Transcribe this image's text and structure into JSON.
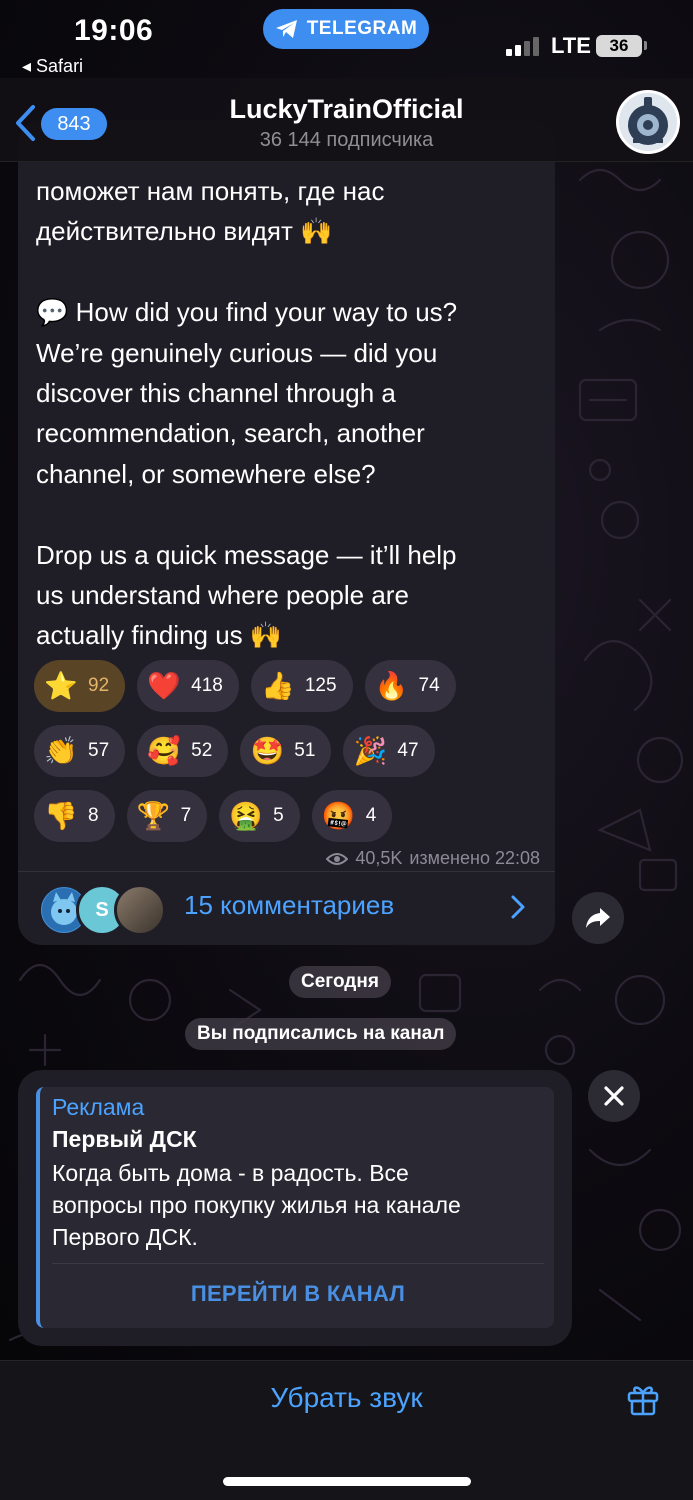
{
  "status_bar": {
    "time": "19:06",
    "back_app": "◂ Safari",
    "app_pill": "TELEGRAM",
    "network": "LTE",
    "battery": "36"
  },
  "header": {
    "back_count": "843",
    "title": "LuckyTrainOfficial",
    "subtitle": "36 144 подписчика"
  },
  "message": {
    "lines": [
      "поможет нам понять, где нас",
      "действительно видят 🙌",
      "",
      "💬 How did you find your way to us?",
      "We’re genuinely curious — did you",
      "discover this channel through a",
      "recommendation, search, another",
      "channel, or somewhere else?",
      "",
      "Drop us a quick message — it’ll help",
      "us understand where people are",
      "actually finding us 🙌"
    ],
    "reactions": [
      [
        {
          "emoji": "⭐",
          "count": "92",
          "name": "star"
        },
        {
          "emoji": "❤️",
          "count": "418",
          "name": "heart"
        },
        {
          "emoji": "👍",
          "count": "125",
          "name": "thumbs-up"
        },
        {
          "emoji": "🔥",
          "count": "74",
          "name": "fire"
        }
      ],
      [
        {
          "emoji": "👏",
          "count": "57",
          "name": "clap"
        },
        {
          "emoji": "🥰",
          "count": "52",
          "name": "smiling-hearts"
        },
        {
          "emoji": "🤩",
          "count": "51",
          "name": "star-struck"
        },
        {
          "emoji": "🎉",
          "count": "47",
          "name": "party-popper"
        }
      ],
      [
        {
          "emoji": "👎",
          "count": "8",
          "name": "thumbs-down"
        },
        {
          "emoji": "🏆",
          "count": "7",
          "name": "trophy"
        },
        {
          "emoji": "🤮",
          "count": "5",
          "name": "vomit"
        },
        {
          "emoji": "🤬",
          "count": "4",
          "name": "cursing"
        }
      ]
    ],
    "views": "40,5K",
    "edited_time": "изменено 22:08",
    "comments_label": "15 комментариев",
    "comment_avatar_letter": "S"
  },
  "service_messages": {
    "date": "Сегодня",
    "subscribed": "Вы подписались на канал"
  },
  "ad": {
    "label": "Реклама",
    "title": "Первый ДСК",
    "text_lines": [
      "Когда быть дома - в радость. Все",
      "вопросы про покупку жилья на канале",
      "Первого ДСК."
    ],
    "button": "ПЕРЕЙТИ В КАНАЛ"
  },
  "bottom_bar": {
    "mute_label": "Убрать звук"
  },
  "colors": {
    "accent": "#4ca3ff",
    "pill": "#3d8ef0",
    "bubble": "#1f1d26",
    "chosen_reaction": "#5a4426"
  }
}
